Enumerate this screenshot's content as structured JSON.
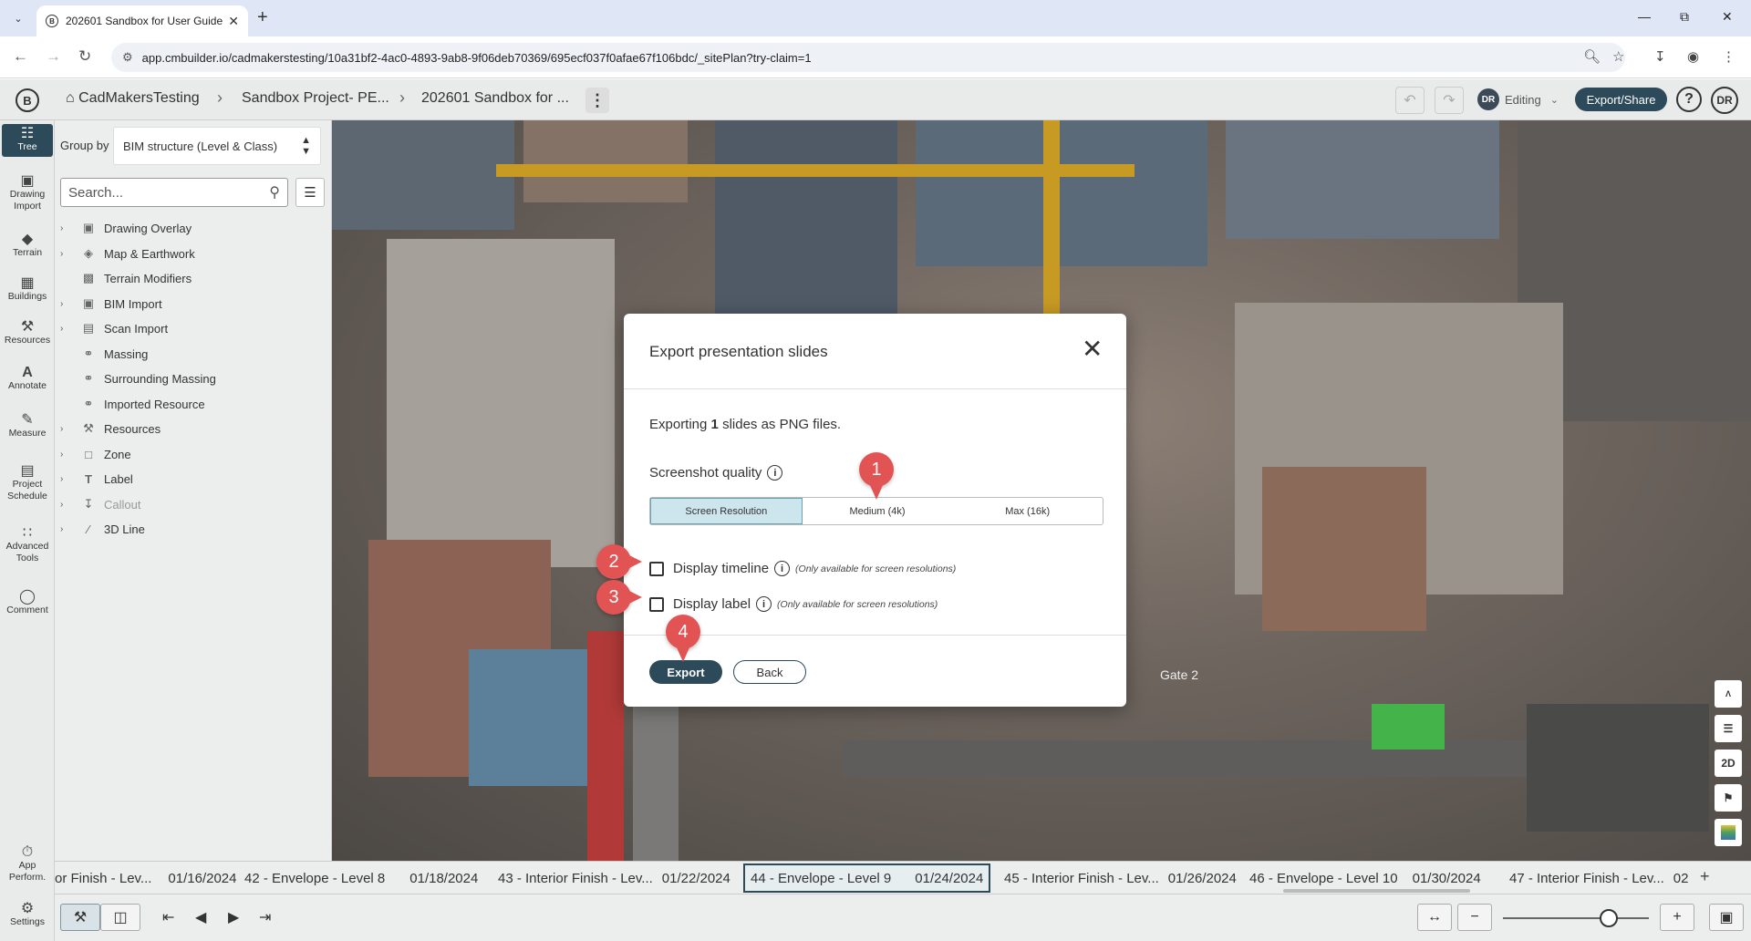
{
  "browser": {
    "tab_title": "202601 Sandbox for User Guide",
    "url": "app.cmbuilder.io/cadmakerstesting/10a31bf2-4ac0-4893-9ab8-9f06deb70369/695ecf037f0afae67f106bdc/_sitePlan?try-claim=1"
  },
  "header": {
    "breadcrumbs": [
      "CadMakersTesting",
      "Sandbox Project- PE...",
      "202601 Sandbox for ..."
    ],
    "editing_user_initials": "DR",
    "editing_label": "Editing",
    "export_share_label": "Export/Share",
    "user_initials": "DR"
  },
  "left_tools": [
    {
      "label": "Tree",
      "icon": "tree-icon",
      "active": true
    },
    {
      "label": "Drawing Import",
      "icon": "image-icon"
    },
    {
      "label": "Terrain",
      "icon": "terrain-icon"
    },
    {
      "label": "Buildings",
      "icon": "buildings-icon"
    },
    {
      "label": "Resources",
      "icon": "resources-icon"
    },
    {
      "label": "Annotate",
      "icon": "annotate-icon"
    },
    {
      "label": "Measure",
      "icon": "ruler-icon"
    },
    {
      "label": "Project Schedule",
      "icon": "schedule-icon"
    },
    {
      "label": "Advanced Tools",
      "icon": "advanced-icon"
    },
    {
      "label": "Comment",
      "icon": "comment-icon"
    },
    {
      "label": "App Perform.",
      "icon": "performance-icon"
    },
    {
      "label": "Settings",
      "icon": "gear-icon"
    }
  ],
  "tree_panel": {
    "group_by_label": "Group by",
    "group_by_value": "BIM structure (Level & Class)",
    "search_placeholder": "Search...",
    "items": [
      {
        "label": "Drawing Overlay",
        "expandable": true
      },
      {
        "label": "Map & Earthwork",
        "expandable": true
      },
      {
        "label": "Terrain Modifiers",
        "expandable": false
      },
      {
        "label": "BIM Import",
        "expandable": true
      },
      {
        "label": "Scan Import",
        "expandable": true
      },
      {
        "label": "Massing",
        "expandable": false
      },
      {
        "label": "Surrounding Massing",
        "expandable": false
      },
      {
        "label": "Imported Resource",
        "expandable": false
      },
      {
        "label": "Resources",
        "expandable": true
      },
      {
        "label": "Zone",
        "expandable": true
      },
      {
        "label": "Label",
        "expandable": true
      },
      {
        "label": "Callout",
        "expandable": true,
        "muted": true
      },
      {
        "label": "3D Line",
        "expandable": true
      }
    ]
  },
  "viewport": {
    "scene_label": "Gate 2",
    "view_controls": [
      "TN",
      "layers",
      "2D",
      "pedestrian",
      "legend"
    ]
  },
  "timeline": {
    "slides": [
      {
        "name": "or Finish - Lev...",
        "date": "01/16/2024"
      },
      {
        "name": "42 - Envelope - Level 8",
        "date": "01/18/2024"
      },
      {
        "name": "43 - Interior Finish - Lev...",
        "date": "01/22/2024"
      },
      {
        "name": "44 - Envelope - Level 9",
        "date": "01/24/2024",
        "active": true
      },
      {
        "name": "45 - Interior Finish - Lev...",
        "date": "01/26/2024"
      },
      {
        "name": "46 - Envelope - Level 10",
        "date": "01/30/2024"
      },
      {
        "name": "47 - Interior Finish - Lev...",
        "date": "02"
      }
    ]
  },
  "modal": {
    "title": "Export presentation slides",
    "export_text_prefix": "Exporting",
    "slide_count": "1",
    "export_text_suffix": "slides as PNG files.",
    "quality_label": "Screenshot quality",
    "quality_options": [
      "Screen Resolution",
      "Medium (4k)",
      "Max (16k)"
    ],
    "quality_selected": "Screen Resolution",
    "display_timeline_label": "Display timeline",
    "display_label_label": "Display label",
    "only_screen_note": "(Only available for screen resolutions)",
    "display_timeline_checked": false,
    "display_label_checked": false,
    "export_button": "Export",
    "back_button": "Back"
  },
  "callouts": [
    "1",
    "2",
    "3",
    "4"
  ],
  "colors": {
    "accent": "#2c4a5a",
    "callout": "#e25454",
    "segment_selected": "#cde5ec"
  }
}
